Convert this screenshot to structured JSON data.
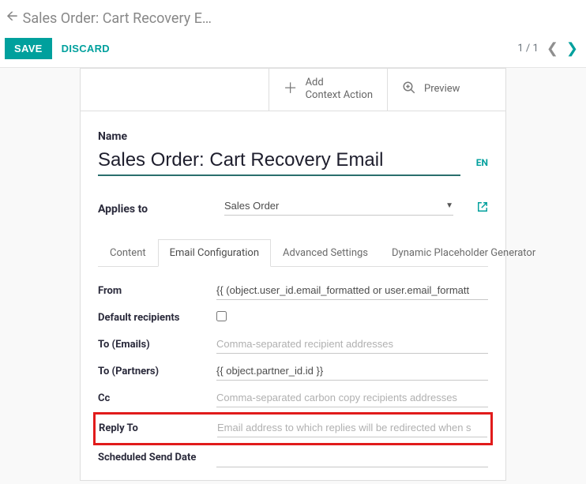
{
  "header": {
    "breadcrumb_title": "Sales Order: Cart Recovery E…",
    "save_label": "SAVE",
    "discard_label": "DISCARD",
    "pager_text": "1 / 1"
  },
  "statbar": {
    "add_context_line1": "Add",
    "add_context_line2": "Context Action",
    "preview_label": "Preview"
  },
  "form": {
    "name_label": "Name",
    "name_value": "Sales Order: Cart Recovery Email",
    "lang": "EN",
    "applies_label": "Applies to",
    "applies_value": "Sales Order"
  },
  "tabs": {
    "content": "Content",
    "email_config": "Email Configuration",
    "advanced": "Advanced Settings",
    "dynamic": "Dynamic Placeholder Generator"
  },
  "fields": {
    "from_label": "From",
    "from_value": "{{ (object.user_id.email_formatted or user.email_formatt",
    "default_recipients_label": "Default recipients",
    "to_emails_label": "To (Emails)",
    "to_emails_placeholder": "Comma-separated recipient addresses",
    "to_partners_label": "To (Partners)",
    "to_partners_value": "{{ object.partner_id.id }}",
    "cc_label": "Cc",
    "cc_placeholder": "Comma-separated carbon copy recipients addresses",
    "reply_to_label": "Reply To",
    "reply_to_placeholder": "Email address to which replies will be redirected when s",
    "scheduled_label": "Scheduled Send Date"
  }
}
